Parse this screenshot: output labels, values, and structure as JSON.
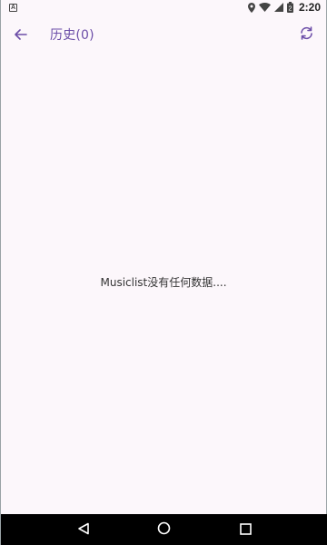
{
  "status_bar": {
    "time": "2:20",
    "notification_icon": "A",
    "icons": [
      "location-icon",
      "wifi-icon",
      "signal-icon",
      "battery-icon"
    ],
    "battery_digit": "2"
  },
  "app_bar": {
    "back_icon": "arrow-left-icon",
    "title": "历史(0)",
    "refresh_icon": "refresh-icon"
  },
  "main": {
    "empty_message": "Musiclist没有任何数据...."
  },
  "nav_bar": {
    "buttons": [
      "back-triangle-icon",
      "home-circle-icon",
      "recents-square-icon"
    ]
  },
  "colors": {
    "accent": "#6c4ea8",
    "background": "#fcf7fb",
    "nav_bar": "#000000"
  }
}
